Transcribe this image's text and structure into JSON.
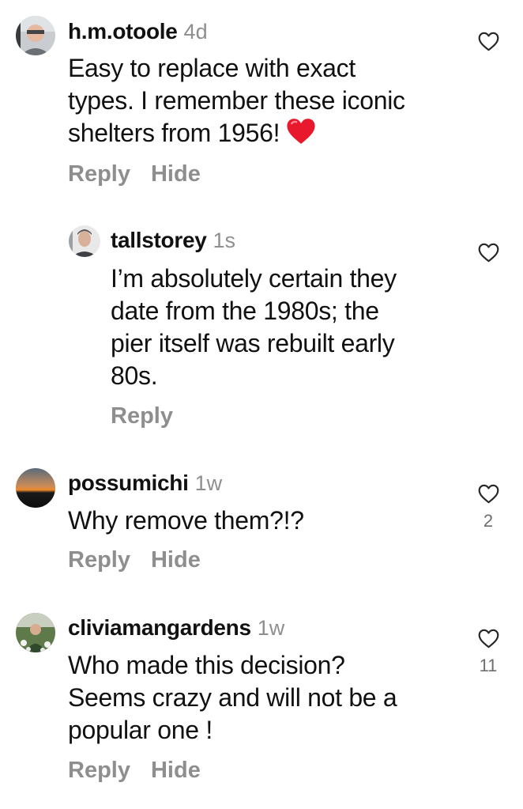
{
  "comments": [
    {
      "username": "h.m.otoole",
      "time": "4d",
      "text_lines": [
        "Easy to replace with exact",
        "types. I remember these iconic",
        "shelters from 1956!"
      ],
      "emoji": "red-heart-emoji",
      "reply_label": "Reply",
      "hide_label": "Hide",
      "likes": ""
    },
    {
      "username": "tallstorey",
      "time": "1s",
      "text_lines": [
        "I’m absolutely certain they",
        "date from the 1980s; the",
        "pier itself was rebuilt early",
        "80s."
      ],
      "reply_label": "Reply",
      "likes": ""
    },
    {
      "username": "possumichi",
      "time": "1w",
      "text_lines": [
        "Why remove them?!?"
      ],
      "reply_label": "Reply",
      "hide_label": "Hide",
      "likes": "2"
    },
    {
      "username": "cliviamangardens",
      "time": "1w",
      "text_lines": [
        "Who made this decision?",
        "Seems crazy and will not be a",
        "popular one !"
      ],
      "reply_label": "Reply",
      "hide_label": "Hide",
      "likes": "11"
    }
  ],
  "colors": {
    "meta": "#8e8e8e",
    "heart": "#ed4956"
  },
  "icons": {
    "like": "heart-outline-icon"
  }
}
